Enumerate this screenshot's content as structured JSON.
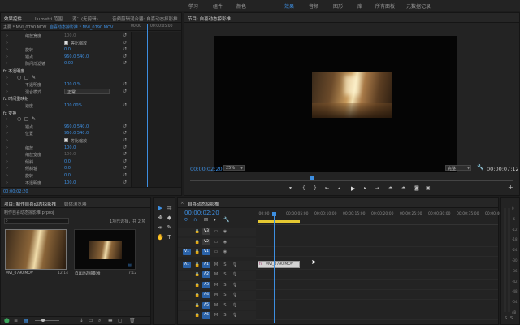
{
  "workspaces": [
    "学习",
    "组件",
    "颜色",
    "效果",
    "音频",
    "图形",
    "库",
    "所有面板",
    "元数据记录"
  ],
  "effect_controls": {
    "tabs": [
      "效果控件",
      "Lumetri 范围",
      "源：(无剪辑)",
      "音频剪辑混合器: 自喜动态掠影推"
    ],
    "source_line": "主要 * MVI_0790.MOV",
    "clip_line": "自喜动态掠影推 * MVI_0790.MOV",
    "rows": [
      {
        "label": "缩放宽度",
        "value": "100.0",
        "dim": true
      },
      {
        "label": "等比缩放",
        "checkbox": true
      },
      {
        "label": "旋转",
        "value": "0.0"
      },
      {
        "label": "锚点",
        "value": "960.0    540.0"
      },
      {
        "label": "防闪烁滤镜",
        "value": "0.00"
      },
      {
        "label": "fx  不透明度",
        "section": true
      },
      {
        "label": "",
        "shapes": true
      },
      {
        "label": "不透明度",
        "value": "100.0 %"
      },
      {
        "label": "混合模式",
        "select": "正常"
      },
      {
        "label": "fx  时间重映射",
        "section": true
      },
      {
        "label": "速度",
        "value": "100.00%"
      },
      {
        "label": "fx  变换",
        "section": true
      },
      {
        "label": "",
        "shapes": true
      },
      {
        "label": "锚点",
        "value": "960.0    540.0"
      },
      {
        "label": "位置",
        "value": "960.0    540.0"
      },
      {
        "label": "等比缩放",
        "checkbox": true
      },
      {
        "label": "缩放",
        "value": "100.0"
      },
      {
        "label": "缩放宽度",
        "value": "100.0",
        "dim": true
      },
      {
        "label": "倾斜",
        "value": "0.0"
      },
      {
        "label": "倾斜轴",
        "value": "0.0"
      },
      {
        "label": "旋转",
        "value": "0.0"
      },
      {
        "label": "不透明度",
        "value": "100.0"
      }
    ],
    "mini_times": [
      "00:00",
      "00:00:05:00"
    ],
    "timecode": "00:00:02:20"
  },
  "program": {
    "title": "节目: 自喜动态掠影推",
    "timecode": "00:00:02:20",
    "zoom": "25%",
    "quality": "完整",
    "duration": "00:00:07:12"
  },
  "project": {
    "tabs": [
      "项目: 制作自喜动态掠影推",
      "媒体浏览器"
    ],
    "filename": "制作自喜动态掠影推.prproj",
    "selection": "1项已选择，共 2 项",
    "items": [
      {
        "name": "MVI_0790.MOV",
        "duration": "12:14"
      },
      {
        "name": "自喜动态掠影推",
        "duration": "7:12"
      }
    ]
  },
  "timeline": {
    "title": "自喜动态掠影推",
    "timecode": "00:00:02:20",
    "ruler": [
      ":00:00",
      "00:00:05:00",
      "00:00:10:00",
      "00:00:15:00",
      "00:00:20:00",
      "00:00:25:00",
      "00:00:30:00",
      "00:00:35:00",
      "00:00:40"
    ],
    "video_tracks": [
      "V3",
      "V2",
      "V1"
    ],
    "audio_tracks": [
      "A1",
      "A2",
      "A3",
      "A4",
      "A5",
      "A6"
    ],
    "clip": "MVI_0790.MOV",
    "playhead_fraction": 0.07
  },
  "meter_labels": [
    "0",
    "-6",
    "-12",
    "-18",
    "-24",
    "-30",
    "-36",
    "-42",
    "-48",
    "-54",
    "dB"
  ],
  "colors": {
    "accent": "#3d8ee0",
    "clip": "#d4d4d4",
    "active_ws": "#3d8ee0"
  }
}
